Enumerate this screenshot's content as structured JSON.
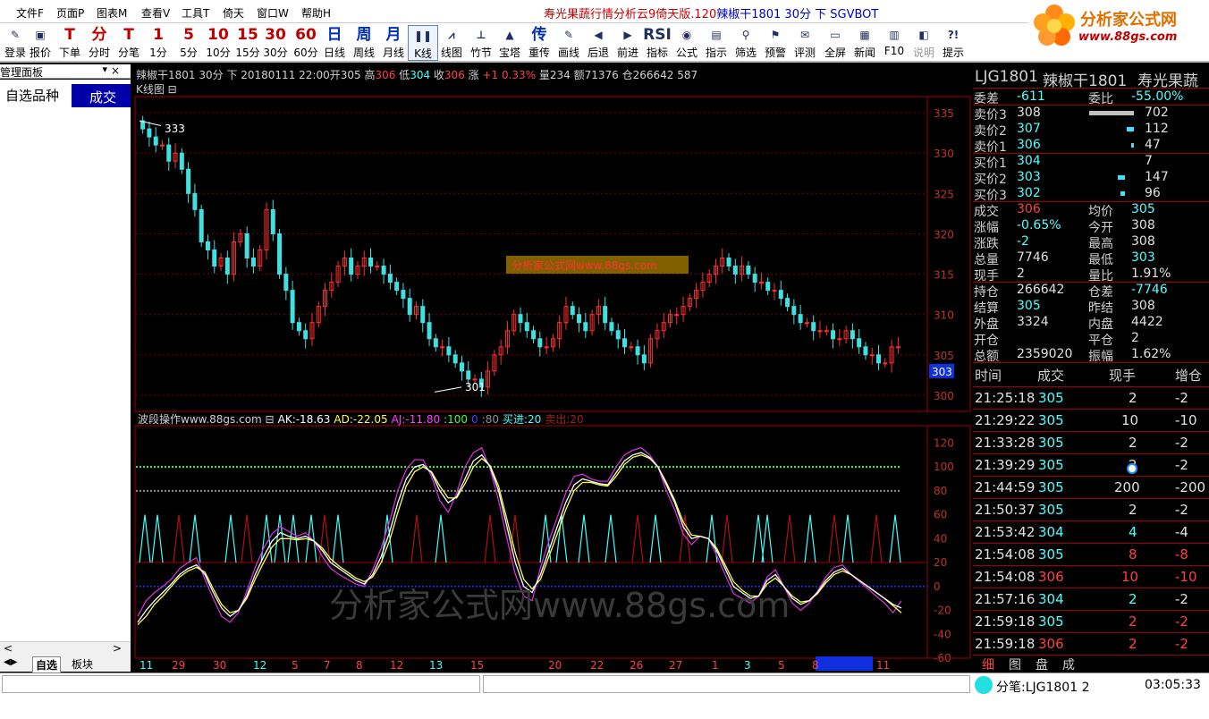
{
  "menubar": {
    "items": [
      "文件F",
      "页面P",
      "图表M",
      "查看V",
      "工具T",
      "倚天",
      "窗口W",
      "帮助H"
    ],
    "title_red": "寿光果蔬行情分析云9倚天版.120",
    "title_blue": "辣椒干1801 30分 下 SGVBOT"
  },
  "logo": {
    "main": "分析家公式网",
    "url": "www.88gs.com"
  },
  "toolbar": {
    "buttons": [
      {
        "icon": "✎",
        "label": "登录"
      },
      {
        "icon": "▣",
        "label": "报价"
      },
      {
        "icon": "T",
        "label": "下单"
      },
      {
        "icon": "分",
        "label": "分时"
      },
      {
        "icon": "T",
        "label": "分笔"
      },
      {
        "icon": "1",
        "label": "1分"
      },
      {
        "icon": "5",
        "label": "5分"
      },
      {
        "icon": "10",
        "label": "10分"
      },
      {
        "icon": "15",
        "label": "15分"
      },
      {
        "icon": "30",
        "label": "30分"
      },
      {
        "icon": "60",
        "label": "60分"
      },
      {
        "icon": "日",
        "label": "日线"
      },
      {
        "icon": "周",
        "label": "周线"
      },
      {
        "icon": "月",
        "label": "月线"
      },
      {
        "icon": "❚❚",
        "label": "K线"
      },
      {
        "icon": "⩘",
        "label": "线图"
      },
      {
        "icon": "⊥",
        "label": "竹节"
      },
      {
        "icon": "▲",
        "label": "宝塔"
      },
      {
        "icon": "传",
        "label": "重传"
      },
      {
        "icon": "✎",
        "label": "画线"
      },
      {
        "icon": "◀",
        "label": "后退"
      },
      {
        "icon": "▶",
        "label": "前进"
      },
      {
        "icon": "RSI",
        "label": "指标"
      },
      {
        "icon": "◉",
        "label": "公式"
      },
      {
        "icon": "▤",
        "label": "指示"
      },
      {
        "icon": "⚲",
        "label": "筛选"
      },
      {
        "icon": "⚑",
        "label": "预警"
      },
      {
        "icon": "✉",
        "label": "评测"
      },
      {
        "icon": "▭",
        "label": "全屏"
      },
      {
        "icon": "▦",
        "label": "新闻"
      },
      {
        "icon": "▥",
        "label": "F10"
      },
      {
        "icon": "◧",
        "label": "说明"
      },
      {
        "icon": "?!",
        "label": "提示"
      }
    ]
  },
  "leftpanel": {
    "header": "管理面板",
    "pin": "▾",
    "close": "×",
    "favorites": "自选品种",
    "deal_tab": "成交",
    "tabs": [
      "自选",
      "板块"
    ],
    "scroll_left": "<",
    "scroll_right": ">"
  },
  "chart": {
    "info_line": {
      "prefix": "辣椒干1801 30分 下 20180111 22:00开305 高",
      "high": "306",
      "low_label": " 低",
      "low": "304",
      "close_label": " 收",
      "close": "306",
      "chg_label": " 涨 ",
      "chg": "+1 0.33%",
      "rest": " 量234 额71376 仓266642 587"
    },
    "kline_label": "K线图 ⊟",
    "price_axis": [
      "335",
      "330",
      "325",
      "320",
      "315",
      "310",
      "305",
      "300"
    ],
    "max_label": "333",
    "min_label": "301",
    "current_price": "303",
    "watermark_small": "分析家公式网www.88gs.com",
    "indicator_header": {
      "name": "波段操作www.88gs.com ⊟",
      "ak": "AK:-18.63",
      "ad": "AD:-22.05",
      "aj": "AJ:-11.80",
      "l100": ":100",
      "l0": "0",
      "l80": ":80",
      "buy": "买进:20",
      "sell": "卖出:20"
    },
    "indicator_axis": [
      "120",
      "100",
      "80",
      "60",
      "40",
      "20",
      "0",
      "-20",
      "-40",
      "-60"
    ],
    "watermark_big": "分析家公式网www.88gs.com",
    "date_axis": [
      "11",
      "29",
      "30",
      "12",
      "5",
      "7",
      "8",
      "12",
      "13",
      "15",
      "20",
      "22",
      "26",
      "27",
      "1",
      "3",
      "5",
      "8",
      "11"
    ]
  },
  "rightpanel": {
    "header": {
      "code": "LJG1801",
      "name": "辣椒干1801",
      "market": "寿光果蔬"
    },
    "weicha_label": "委差",
    "weicha": "-611",
    "weibi_label": "委比",
    "weibi": "-55.00%",
    "asks": [
      {
        "label": "卖价3",
        "price": "308",
        "vol": "702"
      },
      {
        "label": "卖价2",
        "price": "307",
        "vol": "112"
      },
      {
        "label": "卖价1",
        "price": "306",
        "vol": "47"
      }
    ],
    "bids": [
      {
        "label": "买价1",
        "price": "304",
        "vol": "7"
      },
      {
        "label": "买价2",
        "price": "303",
        "vol": "147"
      },
      {
        "label": "买价3",
        "price": "302",
        "vol": "96"
      }
    ],
    "stats": [
      {
        "l1": "成交",
        "v1": "306",
        "c1": "red",
        "l2": "均价",
        "v2": "305",
        "c2": "cyan"
      },
      {
        "l1": "涨幅",
        "v1": "-0.65%",
        "c1": "cyan",
        "l2": "今开",
        "v2": "308",
        "c2": "white"
      },
      {
        "l1": "涨跌",
        "v1": "-2",
        "c1": "cyan",
        "l2": "最高",
        "v2": "308",
        "c2": "white"
      },
      {
        "l1": "总量",
        "v1": "7746",
        "c1": "white",
        "l2": "最低",
        "v2": "303",
        "c2": "cyan"
      },
      {
        "l1": "现手",
        "v1": "2",
        "c1": "white",
        "l2": "量比",
        "v2": "1.91%",
        "c2": "white"
      },
      {
        "l1": "持仓",
        "v1": "266642",
        "c1": "white",
        "l2": "仓差",
        "v2": "-7746",
        "c2": "cyan"
      },
      {
        "l1": "结算",
        "v1": "305",
        "c1": "cyan",
        "l2": "昨结",
        "v2": "308",
        "c2": "white"
      },
      {
        "l1": "外盘",
        "v1": "3324",
        "c1": "white",
        "l2": "内盘",
        "v2": "4422",
        "c2": "white"
      },
      {
        "l1": "开仓",
        "v1": "",
        "c1": "white",
        "l2": "平仓",
        "v2": "2",
        "c2": "white"
      },
      {
        "l1": "总额",
        "v1": "2359020",
        "c1": "white",
        "l2": "振幅",
        "v2": "1.62%",
        "c2": "white"
      }
    ],
    "ticks_header": [
      "时间",
      "成交",
      "现手",
      "增仓"
    ],
    "ticks": [
      {
        "time": "21:25:18",
        "price": "305",
        "pc": "cyan",
        "vol": "2",
        "vc": "white",
        "inc": "-2"
      },
      {
        "time": "21:29:22",
        "price": "305",
        "pc": "cyan",
        "vol": "10",
        "vc": "white",
        "inc": "-10"
      },
      {
        "time": "21:33:28",
        "price": "305",
        "pc": "cyan",
        "vol": "2",
        "vc": "white",
        "inc": "-2"
      },
      {
        "time": "21:39:29",
        "price": "305",
        "pc": "cyan",
        "vol": "2",
        "vc": "white",
        "inc": "-2"
      },
      {
        "time": "21:44:59",
        "price": "305",
        "pc": "cyan",
        "vol": "200",
        "vc": "white",
        "inc": "-200"
      },
      {
        "time": "21:50:37",
        "price": "305",
        "pc": "cyan",
        "vol": "2",
        "vc": "white",
        "inc": "-2"
      },
      {
        "time": "21:53:42",
        "price": "304",
        "pc": "cyan",
        "vol": "4",
        "vc": "cyan",
        "inc": "-4"
      },
      {
        "time": "21:54:08",
        "price": "305",
        "pc": "cyan",
        "vol": "8",
        "vc": "red",
        "inc": "-8"
      },
      {
        "time": "21:54:08",
        "price": "306",
        "pc": "red",
        "vol": "10",
        "vc": "red",
        "inc": "-10"
      },
      {
        "time": "21:57:16",
        "price": "304",
        "pc": "cyan",
        "vol": "2",
        "vc": "cyan",
        "inc": "-2"
      },
      {
        "time": "21:59:18",
        "price": "305",
        "pc": "cyan",
        "vol": "2",
        "vc": "red",
        "inc": "-2"
      },
      {
        "time": "21:59:18",
        "price": "306",
        "pc": "red",
        "vol": "2",
        "vc": "red",
        "inc": "-2"
      }
    ],
    "bottom_tabs": [
      "细",
      "图",
      "盘",
      "成"
    ]
  },
  "statusbar": {
    "ticker": "分笔:LJG1801 2",
    "clock": "03:05:33"
  },
  "chart_data": {
    "type": "candlestick",
    "interval": "30分",
    "yrange": [
      298,
      337
    ],
    "closes": [
      333,
      332,
      331,
      331,
      329,
      330,
      328,
      325,
      323,
      319,
      318,
      316,
      317,
      315,
      319,
      320,
      317,
      316,
      318,
      323,
      320,
      315,
      313,
      309,
      308,
      307,
      309,
      311,
      313,
      314,
      316,
      317,
      315,
      316,
      317,
      316,
      316,
      315,
      314,
      313,
      312,
      310,
      311,
      309,
      307,
      306,
      306,
      305,
      304,
      303,
      302,
      302,
      301,
      303,
      305,
      306,
      308,
      310,
      309,
      308,
      307,
      306,
      306,
      307,
      309,
      311,
      310,
      309,
      308,
      310,
      311,
      309,
      308,
      307,
      306,
      306,
      305,
      304,
      307,
      308,
      309,
      310,
      310,
      311,
      312,
      313,
      314,
      315,
      316,
      317,
      316,
      315,
      316,
      315,
      314,
      314,
      313,
      313,
      312,
      311,
      310,
      309,
      309,
      308,
      308,
      308,
      307,
      307,
      308,
      307,
      306,
      305,
      305,
      304,
      304,
      306,
      306
    ],
    "indicator": {
      "type": "line",
      "yrange": [
        -60,
        130
      ],
      "reference_lines": [
        100,
        80,
        20,
        0
      ],
      "ak": [
        -30,
        -20,
        -12,
        -5,
        2,
        10,
        15,
        18,
        10,
        -5,
        -18,
        -25,
        -20,
        -8,
        10,
        25,
        38,
        45,
        42,
        40,
        42,
        38,
        30,
        20,
        15,
        10,
        5,
        2,
        10,
        25,
        45,
        70,
        90,
        100,
        102,
        95,
        80,
        70,
        75,
        90,
        105,
        110,
        100,
        80,
        50,
        20,
        0,
        -5,
        10,
        30,
        50,
        70,
        85,
        90,
        88,
        86,
        85,
        95,
        105,
        110,
        112,
        108,
        100,
        85,
        70,
        50,
        40,
        42,
        40,
        30,
        15,
        0,
        -5,
        -10,
        -8,
        5,
        10,
        0,
        -10,
        -15,
        -12,
        -5,
        5,
        12,
        15,
        10,
        5,
        0,
        -5,
        -10,
        -15,
        -18
      ],
      "ad": [
        -32,
        -25,
        -15,
        -8,
        0,
        8,
        13,
        16,
        12,
        -2,
        -15,
        -22,
        -20,
        -10,
        6,
        20,
        33,
        40,
        40,
        39,
        40,
        38,
        32,
        23,
        17,
        12,
        7,
        4,
        8,
        20,
        38,
        62,
        84,
        96,
        100,
        96,
        84,
        74,
        74,
        86,
        100,
        107,
        101,
        84,
        56,
        28,
        6,
        -2,
        6,
        25,
        44,
        64,
        80,
        87,
        87,
        85,
        84,
        92,
        102,
        108,
        110,
        107,
        100,
        87,
        72,
        54,
        43,
        42,
        40,
        32,
        18,
        4,
        -3,
        -8,
        -8,
        2,
        7,
        0,
        -8,
        -13,
        -12,
        -6,
        3,
        10,
        13,
        10,
        5,
        0,
        -5,
        -10,
        -16,
        -22
      ],
      "aj": [
        -25,
        -12,
        -5,
        0,
        6,
        15,
        20,
        24,
        6,
        -10,
        -25,
        -30,
        -22,
        -4,
        16,
        32,
        44,
        50,
        46,
        42,
        45,
        38,
        25,
        15,
        10,
        6,
        2,
        0,
        14,
        32,
        54,
        80,
        98,
        106,
        106,
        92,
        72,
        62,
        78,
        100,
        112,
        116,
        98,
        72,
        40,
        10,
        -8,
        -12,
        16,
        38,
        58,
        78,
        92,
        94,
        90,
        88,
        88,
        100,
        110,
        114,
        116,
        110,
        100,
        80,
        64,
        44,
        35,
        42,
        40,
        26,
        10,
        -6,
        -10,
        -14,
        -8,
        8,
        14,
        0,
        -14,
        -20,
        -14,
        -4,
        8,
        16,
        18,
        10,
        4,
        -2,
        -8,
        -14,
        -22,
        -12
      ]
    }
  }
}
